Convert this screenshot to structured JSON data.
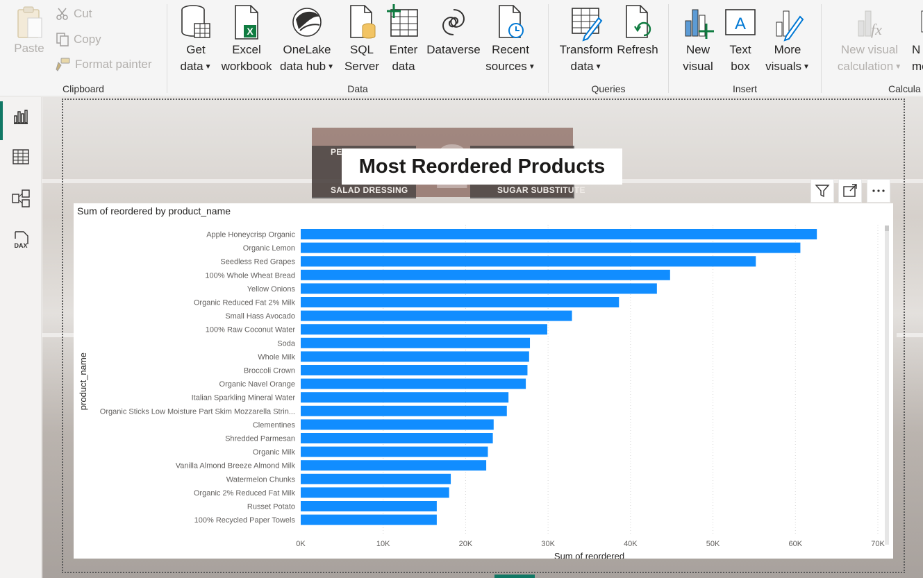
{
  "ribbon": {
    "clipboard": {
      "label": "Clipboard",
      "paste": "Paste",
      "cut": "Cut",
      "copy": "Copy",
      "format_painter": "Format painter"
    },
    "data": {
      "label": "Data",
      "get_data": [
        "Get",
        "data"
      ],
      "excel": [
        "Excel",
        "workbook"
      ],
      "onelake": [
        "OneLake",
        "data hub"
      ],
      "sql": [
        "SQL",
        "Server"
      ],
      "enter": [
        "Enter",
        "data"
      ],
      "dataverse": "Dataverse",
      "recent": [
        "Recent",
        "sources"
      ]
    },
    "queries": {
      "label": "Queries",
      "transform": [
        "Transform",
        "data"
      ],
      "refresh": "Refresh"
    },
    "insert": {
      "label": "Insert",
      "new_visual": [
        "New",
        "visual"
      ],
      "text_box": [
        "Text",
        "box"
      ],
      "more_visuals": [
        "More",
        "visuals"
      ]
    },
    "calculations": {
      "label": "Calcula",
      "new_visual_calc": [
        "New visual",
        "calculation"
      ],
      "new_measure": [
        "N",
        "me"
      ]
    }
  },
  "leftnav": {
    "items": [
      "report-view-icon",
      "table-view-icon",
      "model-view-icon",
      "dax-query-icon"
    ],
    "dax_label": "DAX"
  },
  "canvas": {
    "title": "Most Reordered Products",
    "sign_left_top": "PE",
    "sign_left_bottom": "SALAD DRESSING",
    "sign_right_bottom": "SUGAR SUBSTITUTE",
    "sign_number": "2"
  },
  "colors": {
    "bar": "#118dff",
    "accent": "#117865"
  },
  "chart_data": {
    "type": "bar",
    "orientation": "horizontal",
    "title": "Sum of reordered by product_name",
    "xlabel": "Sum of reordered",
    "ylabel": "product_name",
    "xlim": [
      0,
      70000
    ],
    "xticks": [
      "0K",
      "10K",
      "20K",
      "30K",
      "40K",
      "50K",
      "60K",
      "70K"
    ],
    "grid": "vertical dotted",
    "categories": [
      "Apple Honeycrisp Organic",
      "Organic Lemon",
      "Seedless Red Grapes",
      "100% Whole Wheat Bread",
      "Yellow Onions",
      "Organic Reduced Fat 2% Milk",
      "Small Hass Avocado",
      "100% Raw Coconut Water",
      "Soda",
      "Whole Milk",
      "Broccoli Crown",
      "Organic Navel Orange",
      "Italian Sparkling Mineral Water",
      "Organic Sticks Low Moisture Part Skim Mozzarella Strin...",
      "Clementines",
      "Shredded Parmesan",
      "Organic Milk",
      "Vanilla Almond Breeze Almond Milk",
      "Watermelon Chunks",
      "Organic 2% Reduced Fat Milk",
      "Russet Potato",
      "100% Recycled Paper Towels"
    ],
    "values": [
      62600,
      60600,
      55200,
      44800,
      43200,
      38600,
      32900,
      29900,
      27800,
      27700,
      27500,
      27300,
      25200,
      25000,
      23400,
      23300,
      22700,
      22500,
      18200,
      18000,
      16500,
      16500
    ]
  }
}
